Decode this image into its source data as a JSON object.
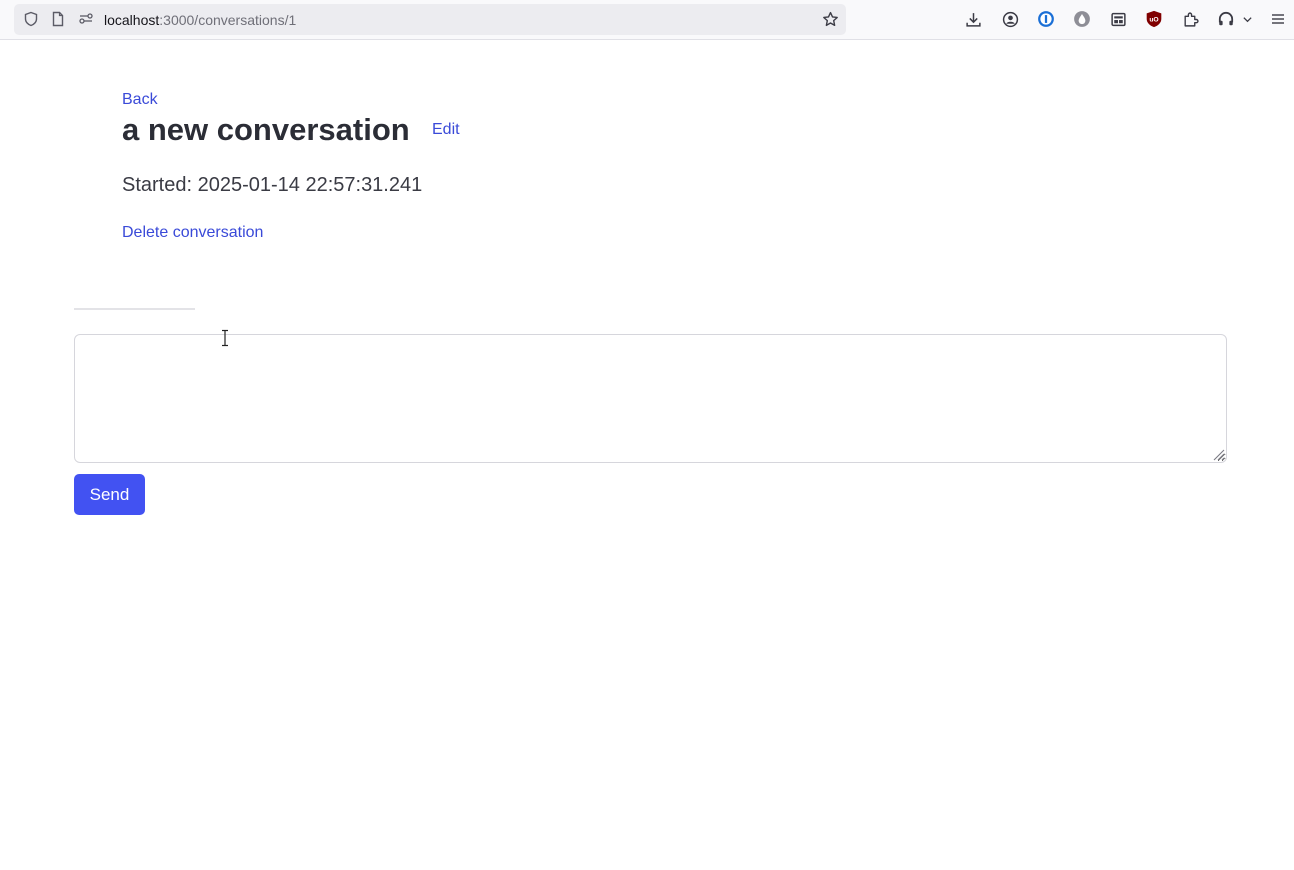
{
  "browser": {
    "url_host": "localhost",
    "url_path": ":3000/conversations/1"
  },
  "page": {
    "back_label": "Back",
    "title": "a new conversation",
    "edit_label": "Edit",
    "started_text": "Started: 2025-01-14 22:57:31.241",
    "delete_label": "Delete conversation",
    "message_value": "",
    "send_label": "Send"
  },
  "colors": {
    "link": "#3a4ad8",
    "button": "#4252f2",
    "text": "#2b2d36"
  },
  "icons": {
    "urlbar": [
      "shield-icon",
      "page-icon",
      "permissions-icon",
      "bookmark-star-icon"
    ],
    "toolbar": [
      "download-icon",
      "account-icon",
      "password-manager-icon",
      "extension-drop-icon",
      "reader-icon",
      "ublock-icon",
      "extensions-icon",
      "headphones-icon",
      "chevron-down-icon",
      "menu-icon"
    ]
  }
}
